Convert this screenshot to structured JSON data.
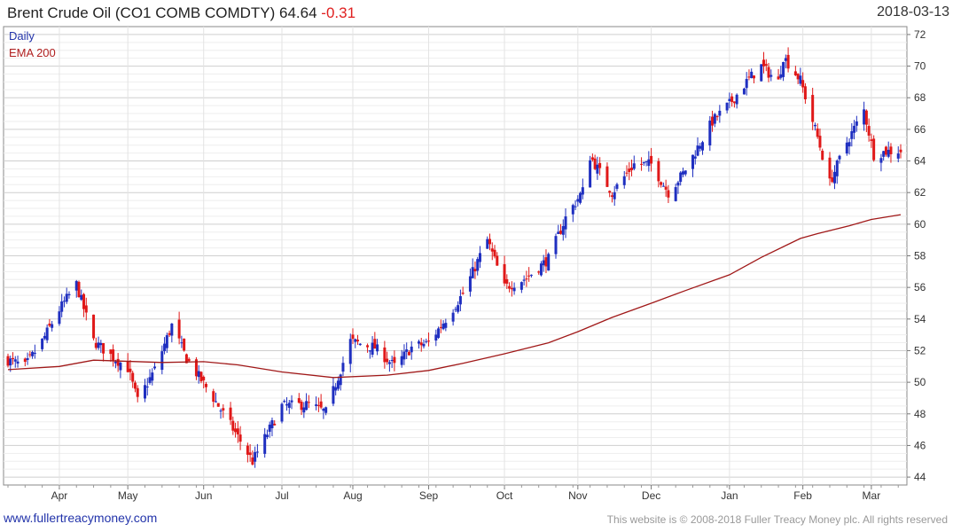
{
  "header": {
    "title": "Brent Crude Oil  (CO1 COMB COMDTY)",
    "price": "64.64",
    "change": "-0.31",
    "date": "2018-03-13"
  },
  "legend": {
    "daily": "Daily",
    "ema": "EMA 200"
  },
  "colors": {
    "up": "#1f2fc0",
    "down": "#e01818",
    "ema": "#a01818",
    "grid": "#dddddd"
  },
  "footer": {
    "site": "www.fullertreacymoney.com",
    "copyright": "This website is © 2008-2018 Fuller Treacy Money plc. All rights reserved"
  },
  "chart_data": {
    "type": "candlestick",
    "ylim": [
      43.5,
      72.5
    ],
    "y_ticks": [
      44,
      46,
      48,
      50,
      52,
      54,
      56,
      58,
      60,
      62,
      64,
      66,
      68,
      70,
      72
    ],
    "x_ticks": [
      {
        "label": "Apr",
        "date": "2017-04-03"
      },
      {
        "label": "May",
        "date": "2017-05-01"
      },
      {
        "label": "Jun",
        "date": "2017-06-01"
      },
      {
        "label": "Jul",
        "date": "2017-07-03"
      },
      {
        "label": "Aug",
        "date": "2017-08-01"
      },
      {
        "label": "Sep",
        "date": "2017-09-01"
      },
      {
        "label": "Oct",
        "date": "2017-10-02"
      },
      {
        "label": "Nov",
        "date": "2017-11-01"
      },
      {
        "label": "Dec",
        "date": "2017-12-01"
      },
      {
        "label": "Jan",
        "date": "2018-01-02"
      },
      {
        "label": "Feb",
        "date": "2018-02-01"
      },
      {
        "label": "Mar",
        "date": "2018-03-01"
      }
    ],
    "close_path": [
      [
        "2017-03-13",
        51.4
      ],
      [
        "2017-03-20",
        51.0
      ],
      [
        "2017-03-27",
        52.6
      ],
      [
        "2017-04-03",
        54.6
      ],
      [
        "2017-04-10",
        56.2
      ],
      [
        "2017-04-17",
        52.6
      ],
      [
        "2017-04-24",
        51.7
      ],
      [
        "2017-05-01",
        50.9
      ],
      [
        "2017-05-05",
        48.8
      ],
      [
        "2017-05-12",
        50.8
      ],
      [
        "2017-05-19",
        53.6
      ],
      [
        "2017-05-25",
        51.5
      ],
      [
        "2017-06-05",
        49.0
      ],
      [
        "2017-06-14",
        46.8
      ],
      [
        "2017-06-21",
        45.0
      ],
      [
        "2017-07-03",
        48.5
      ],
      [
        "2017-07-14",
        48.6
      ],
      [
        "2017-07-21",
        48.1
      ],
      [
        "2017-07-31",
        52.6
      ],
      [
        "2017-08-10",
        52.2
      ],
      [
        "2017-08-18",
        51.0
      ],
      [
        "2017-08-25",
        52.2
      ],
      [
        "2017-09-01",
        52.5
      ],
      [
        "2017-09-08",
        54.0
      ],
      [
        "2017-09-15",
        55.6
      ],
      [
        "2017-09-25",
        59.0
      ],
      [
        "2017-10-02",
        56.0
      ],
      [
        "2017-10-11",
        56.6
      ],
      [
        "2017-10-20",
        57.8
      ],
      [
        "2017-10-27",
        60.4
      ],
      [
        "2017-11-03",
        62.1
      ],
      [
        "2017-11-06",
        64.3
      ],
      [
        "2017-11-15",
        62.0
      ],
      [
        "2017-11-24",
        63.8
      ],
      [
        "2017-12-01",
        63.8
      ],
      [
        "2017-12-08",
        62.0
      ],
      [
        "2017-12-14",
        63.2
      ],
      [
        "2017-12-26",
        66.5
      ],
      [
        "2018-01-02",
        67.6
      ],
      [
        "2018-01-10",
        69.2
      ],
      [
        "2018-01-15",
        70.0
      ],
      [
        "2018-01-22",
        69.0
      ],
      [
        "2018-01-24",
        70.6
      ],
      [
        "2018-01-31",
        69.1
      ],
      [
        "2018-02-07",
        65.5
      ],
      [
        "2018-02-12",
        62.6
      ],
      [
        "2018-02-19",
        65.2
      ],
      [
        "2018-02-26",
        67.2
      ],
      [
        "2018-03-02",
        64.4
      ],
      [
        "2018-03-07",
        64.6
      ],
      [
        "2018-03-13",
        64.64
      ]
    ],
    "ema200": [
      [
        "2017-03-13",
        50.8
      ],
      [
        "2017-04-03",
        51.0
      ],
      [
        "2017-04-17",
        51.4
      ],
      [
        "2017-05-15",
        51.25
      ],
      [
        "2017-06-01",
        51.3
      ],
      [
        "2017-06-15",
        51.1
      ],
      [
        "2017-07-03",
        50.65
      ],
      [
        "2017-07-24",
        50.3
      ],
      [
        "2017-08-15",
        50.45
      ],
      [
        "2017-09-01",
        50.75
      ],
      [
        "2017-09-15",
        51.2
      ],
      [
        "2017-10-02",
        51.8
      ],
      [
        "2017-10-20",
        52.5
      ],
      [
        "2017-11-01",
        53.2
      ],
      [
        "2017-11-15",
        54.1
      ],
      [
        "2017-12-01",
        55.0
      ],
      [
        "2017-12-15",
        55.8
      ],
      [
        "2018-01-02",
        56.8
      ],
      [
        "2018-01-15",
        57.9
      ],
      [
        "2018-01-31",
        59.1
      ],
      [
        "2018-02-07",
        59.4
      ],
      [
        "2018-02-20",
        59.9
      ],
      [
        "2018-03-01",
        60.3
      ],
      [
        "2018-03-13",
        60.6
      ]
    ]
  }
}
